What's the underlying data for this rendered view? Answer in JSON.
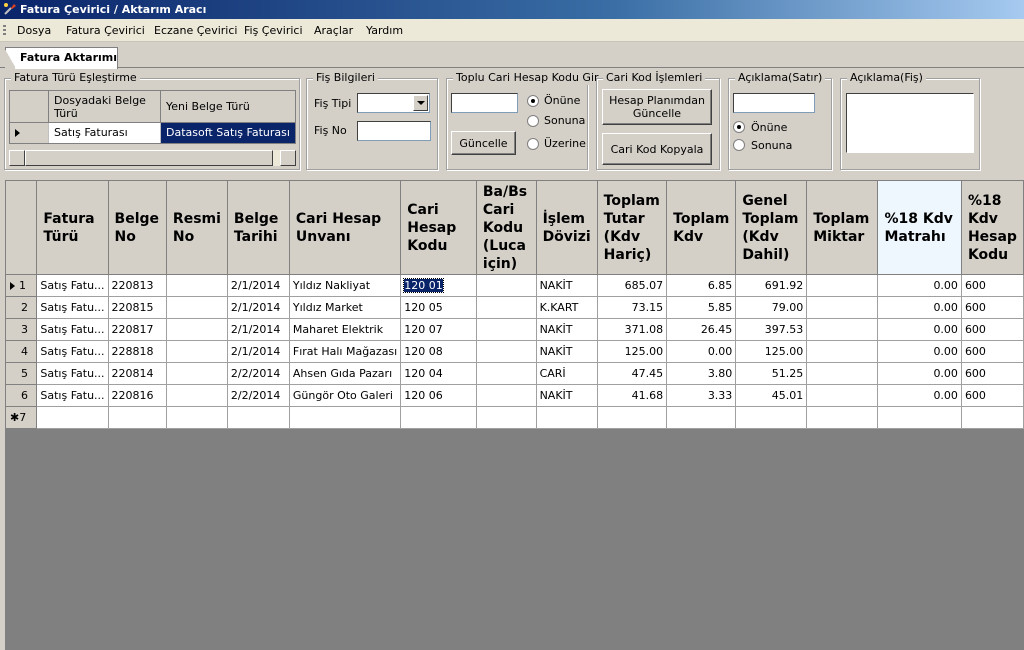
{
  "window": {
    "title": "Fatura Çevirici / Aktarım Aracı"
  },
  "menu": [
    "Dosya",
    "Fatura Çevirici",
    "Eczane Çevirici",
    "Fiş Çevirici",
    "Araçlar",
    "Yardım"
  ],
  "tab": {
    "label": "Fatura Aktarımı"
  },
  "fatura_turu": {
    "title": "Fatura Türü Eşleştirme",
    "col1": "Dosyadaki Belge Türü",
    "col2": "Yeni Belge Türü",
    "row_source": "Satış Faturası",
    "row_target": "Datasoft Satış Faturası"
  },
  "fis_bilgileri": {
    "title": "Fiş Bilgileri",
    "fis_tipi_label": "Fiş Tipi",
    "fis_tipi_value": "",
    "fis_no_label": "Fiş No",
    "fis_no_value": ""
  },
  "toplu_cari": {
    "title": "Toplu Cari Hesap Kodu Gir",
    "input_value": "",
    "onune": "Önüne",
    "sonuna": "Sonuna",
    "uzerine": "Üzerine",
    "guncelle": "Güncelle",
    "selected": "Önüne"
  },
  "cari_kod": {
    "title": "Cari Kod İşlemleri",
    "btn_hesap": "Hesap Planımdan Güncelle",
    "btn_kopyala": "Cari Kod Kopyala"
  },
  "aciklama_satir": {
    "title": "Açıklama(Satır)",
    "value": "",
    "onune": "Önüne",
    "sonuna": "Sonuna",
    "selected": "Önüne"
  },
  "aciklama_fis": {
    "title": "Açıklama(Fiş)",
    "value": ""
  },
  "grid": {
    "columns": [
      "Fatura Türü",
      "Belge No",
      "Resmi No",
      "Belge Tarihi",
      "Cari Hesap Unvanı",
      "Cari Hesap Kodu",
      "Ba/Bs Cari Kodu (Luca için)",
      "İşlem Dövizi",
      "Toplam Tutar (Kdv Hariç)",
      "Toplam Kdv",
      "Genel Toplam (Kdv Dahil)",
      "Toplam Miktar",
      "%18 Kdv Matrahı",
      "%18 Kdv Hesap Kodu"
    ],
    "rows": [
      {
        "n": "1",
        "tur": "Satış Fatu...",
        "belge": "220813",
        "resmi": "",
        "tarih": "2/1/2014",
        "unvan": "Yıldız Nakliyat",
        "kod": "120 01",
        "babs": "",
        "doviz": "NAKİT",
        "tutar": "685.07",
        "kdv": "6.85",
        "genel": "691.92",
        "miktar": "",
        "matrah": "0.00",
        "hkod": "600"
      },
      {
        "n": "2",
        "tur": "Satış Fatu...",
        "belge": "220815",
        "resmi": "",
        "tarih": "2/1/2014",
        "unvan": "Yıldız Market",
        "kod": "120 05",
        "babs": "",
        "doviz": "K.KART",
        "tutar": "73.15",
        "kdv": "5.85",
        "genel": "79.00",
        "miktar": "",
        "matrah": "0.00",
        "hkod": "600"
      },
      {
        "n": "3",
        "tur": "Satış Fatu...",
        "belge": "220817",
        "resmi": "",
        "tarih": "2/1/2014",
        "unvan": "Maharet Elektrik",
        "kod": "120 07",
        "babs": "",
        "doviz": "NAKİT",
        "tutar": "371.08",
        "kdv": "26.45",
        "genel": "397.53",
        "miktar": "",
        "matrah": "0.00",
        "hkod": "600"
      },
      {
        "n": "4",
        "tur": "Satış Fatu...",
        "belge": "228818",
        "resmi": "",
        "tarih": "2/1/2014",
        "unvan": "Fırat Halı Mağazası",
        "kod": "120 08",
        "babs": "",
        "doviz": "NAKİT",
        "tutar": "125.00",
        "kdv": "0.00",
        "genel": "125.00",
        "miktar": "",
        "matrah": "0.00",
        "hkod": "600"
      },
      {
        "n": "5",
        "tur": "Satış Fatu...",
        "belge": "220814",
        "resmi": "",
        "tarih": "2/2/2014",
        "unvan": "Ahsen Gıda Pazarı",
        "kod": "120 04",
        "babs": "",
        "doviz": "CARİ",
        "tutar": "47.45",
        "kdv": "3.80",
        "genel": "51.25",
        "miktar": "",
        "matrah": "0.00",
        "hkod": "600"
      },
      {
        "n": "6",
        "tur": "Satış Fatu...",
        "belge": "220816",
        "resmi": "",
        "tarih": "2/2/2014",
        "unvan": "Güngör Oto Galeri",
        "kod": "120 06",
        "babs": "",
        "doviz": "NAKİT",
        "tutar": "41.68",
        "kdv": "3.33",
        "genel": "45.01",
        "miktar": "",
        "matrah": "0.00",
        "hkod": "600"
      }
    ],
    "new_row_marker": "✱7"
  }
}
